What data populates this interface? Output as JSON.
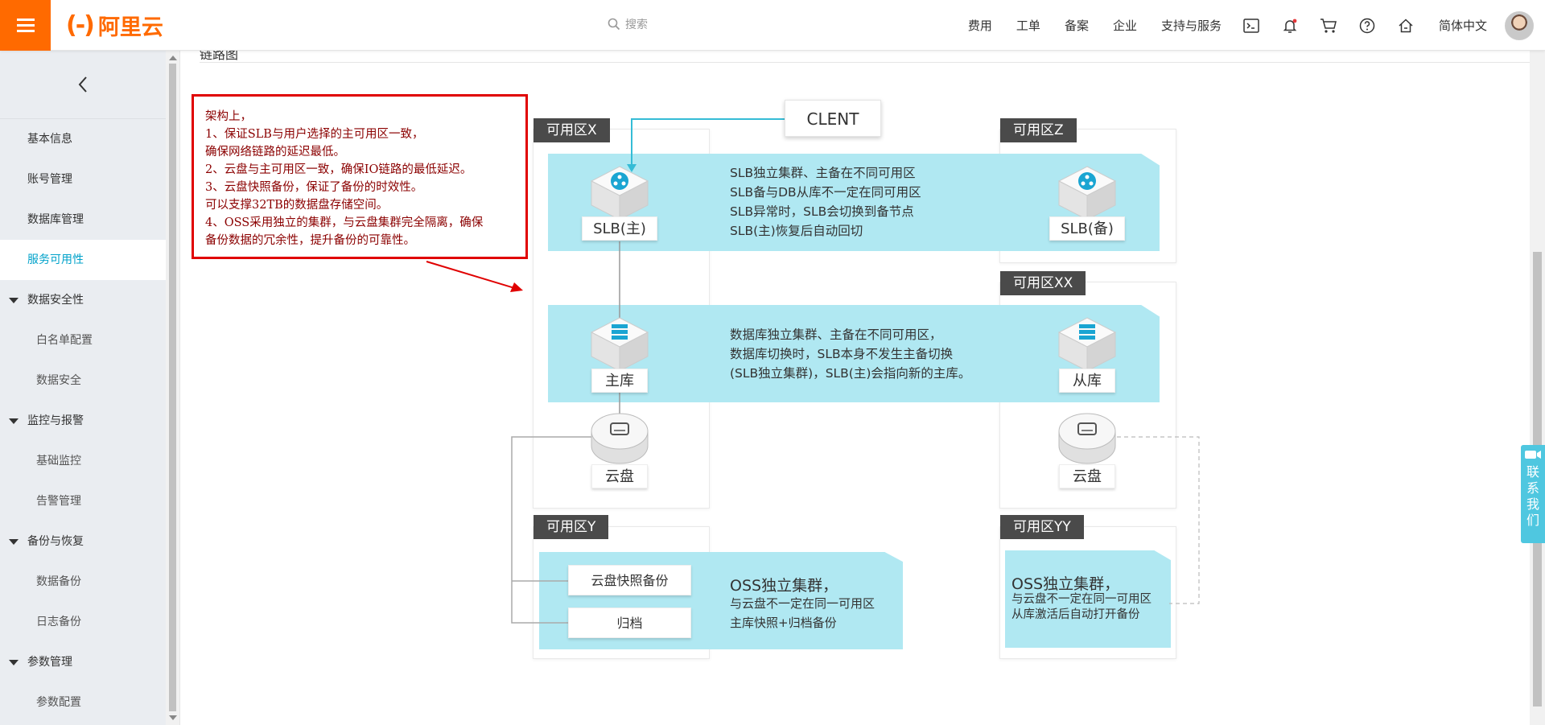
{
  "brand": {
    "logo_mark": "(-)",
    "logo_text": "阿里云",
    "accent": "#ff6a00"
  },
  "header": {
    "search_placeholder": "搜索",
    "nav": [
      "费用",
      "工单",
      "备案",
      "企业",
      "支持与服务"
    ],
    "language": "简体中文",
    "icons": [
      "terminal-icon",
      "bell-icon",
      "cart-icon",
      "help-icon",
      "home-icon"
    ]
  },
  "sidebar": {
    "items": [
      {
        "label": "基本信息",
        "type": "item"
      },
      {
        "label": "账号管理",
        "type": "item"
      },
      {
        "label": "数据库管理",
        "type": "item"
      },
      {
        "label": "服务可用性",
        "type": "item",
        "active": true
      },
      {
        "label": "数据安全性",
        "type": "group"
      },
      {
        "label": "白名单配置",
        "type": "sub"
      },
      {
        "label": "数据安全",
        "type": "sub"
      },
      {
        "label": "监控与报警",
        "type": "group"
      },
      {
        "label": "基础监控",
        "type": "sub"
      },
      {
        "label": "告警管理",
        "type": "sub"
      },
      {
        "label": "备份与恢复",
        "type": "group"
      },
      {
        "label": "数据备份",
        "type": "sub"
      },
      {
        "label": "日志备份",
        "type": "sub"
      },
      {
        "label": "参数管理",
        "type": "group"
      },
      {
        "label": "参数配置",
        "type": "sub"
      }
    ]
  },
  "main": {
    "section_title": "链路图",
    "note": [
      "架构上，",
      "1、保证SLB与用户选择的主可用区一致，",
      "确保网络链路的延迟最低。",
      "2、云盘与主可用区一致，确保IO链路的最低延迟。",
      "3、云盘快照备份，保证了备份的时效性。",
      "可以支撑32TB的数据盘存储空间。",
      "4、OSS采用独立的集群，与云盘集群完全隔离，确保",
      "备份数据的冗余性，提升备份的可靠性。"
    ]
  },
  "diagram": {
    "client": "CLENT",
    "zones": {
      "x": "可用区X",
      "z": "可用区Z",
      "xx": "可用区XX",
      "y": "可用区Y",
      "yy": "可用区YY"
    },
    "slb_main": "SLB(主)",
    "slb_backup": "SLB(备)",
    "db_main": "主库",
    "db_replica": "从库",
    "disk_main": "云盘",
    "disk_replica": "云盘",
    "slb_desc": [
      "SLB独立集群、主备在不同可用区",
      "SLB备与DB从库不一定在同可用区",
      "SLB异常时，SLB会切换到备节点",
      "SLB(主)恢复后自动回切"
    ],
    "db_desc": [
      "数据库独立集群、主备在不同可用区，",
      "数据库切换时，SLB本身不发生主备切换",
      "(SLB独立集群)，SLB(主)会指向新的主库。"
    ],
    "snapshot": "云盘快照备份",
    "archive": "归档",
    "oss_y_title": "OSS独立集群，",
    "oss_y_desc": [
      "与云盘不一定在同一可用区",
      "主库快照+归档备份"
    ],
    "oss_yy_title": "OSS独立集群，",
    "oss_yy_desc": [
      "与云盘不一定在同一可用区",
      "从库激活后自动打开备份"
    ]
  },
  "contact": "联系我们",
  "colors": {
    "band": "#b0e8f2",
    "active": "#00a2ca",
    "note_border": "#e00000",
    "client_line": "#35bcd6"
  }
}
